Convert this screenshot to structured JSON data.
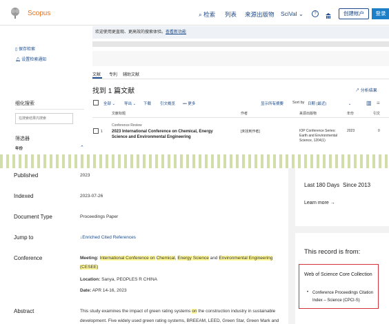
{
  "header": {
    "brand": "Scopus",
    "nav": [
      "检索",
      "列表",
      "来源出版物",
      "SciVal"
    ],
    "scival_caret": "⌄",
    "help_icon": "?",
    "account_icon": "user",
    "register": "创建帐户",
    "login": "登录"
  },
  "banner": {
    "text": "欢迎使用更直观、更高效的搜索体验。",
    "link": "查看新功能"
  },
  "sidebar": {
    "save": "保存检索",
    "alert": "设置检索通知",
    "refine": "细化搜索",
    "search_placeholder": "在搜索结果内搜索",
    "filters": "筛选器",
    "year": "年份"
  },
  "tabs": [
    "文献",
    "专利",
    "辅助文献"
  ],
  "results": {
    "count": "找到 1 篇文献",
    "analyze": "分析结果"
  },
  "toolbar": {
    "all": "全部",
    "export": "导出",
    "download": "下载",
    "citation": "引文概览",
    "more": "更多",
    "show_abstract": "显示所有摘要",
    "sort_label": "Sort by",
    "sort_value": "日期 (最近)"
  },
  "columns": {
    "title": "文献标题",
    "authors": "作者",
    "source": "来源出版物",
    "year": "年份",
    "cited": "引文"
  },
  "row": {
    "index": "1",
    "type": "Conference Review",
    "title": "2023 International Conference on Chemical, Energy Science and Environmental Engineering",
    "authors": "[未找到作者]",
    "source": "IOP Conference Series: Earth and Environmental Science, 1204(1)",
    "year": "2023",
    "cited": "0"
  },
  "record": {
    "published_label": "Published",
    "published": "2023",
    "indexed_label": "Indexed",
    "indexed": "2023-07-26",
    "doctype_label": "Document Type",
    "doctype": "Proceedings Paper",
    "jump_label": "Jump to",
    "jump": "Enriched Cited References",
    "conf_label": "Conference",
    "meeting_label": "Meeting:",
    "meeting_parts": [
      "International Conference on",
      "Chemical",
      ",",
      "Energy Science",
      "and",
      "Environmental Engineering"
    ],
    "meeting_acr": "(CESEE)",
    "location_label": "Location:",
    "location": "Sanya, PEOPLES R CHINA",
    "date_label": "Date:",
    "date": "APR 14-16, 2023",
    "abstract_label": "Abstract",
    "abstract_l1_a": "This study examines the impact of green rating systems",
    "abstract_l1_on": "on",
    "abstract_l1_b": "the construction industry in sustainable",
    "abstract_l2": "development. Five widely used green rating systems, BREEAM, LEED, Green Star, Green Mark and"
  },
  "right": {
    "last180": "Last 180 Days",
    "since": "Since 2013",
    "learn": "Learn more",
    "from_title": "This record is from:",
    "wos": "Web of Science Core Collection",
    "index": "Conference Proceedings Citation Index – Science (CPCI-S)"
  }
}
